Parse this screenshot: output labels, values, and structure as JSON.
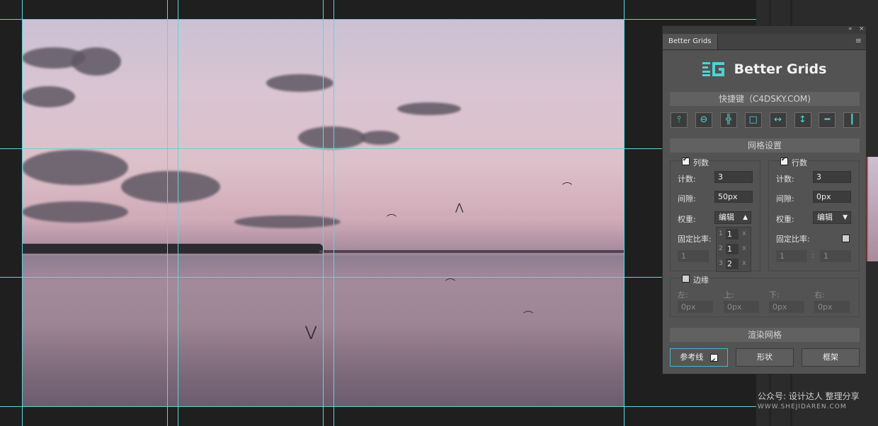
{
  "colors": {
    "guide": "#5fd6db",
    "accent": "#4fd2d6",
    "panel_bg": "#535353"
  },
  "panel": {
    "tab_title": "Better Grids",
    "brand_title": "Better Grids",
    "top_controls": {
      "collapse": "«",
      "close": "×"
    },
    "menu_icon": "≡"
  },
  "shortcuts": {
    "header": "快捷键（C4DSKY.COM)",
    "buttons": [
      {
        "icon": "center-vertical-line-icon",
        "glyph": "⫯"
      },
      {
        "icon": "center-horizontal-line-icon",
        "glyph": "⊖"
      },
      {
        "icon": "center-cross-icon",
        "glyph": "╬"
      },
      {
        "icon": "frame-square-icon",
        "glyph": "□"
      },
      {
        "icon": "horizontal-arrows-icon",
        "glyph": "↔"
      },
      {
        "icon": "vertical-arrows-icon",
        "glyph": "↕"
      },
      {
        "icon": "horizontal-line-icon",
        "glyph": "━"
      },
      {
        "icon": "vertical-line-icon",
        "glyph": "┃"
      }
    ]
  },
  "grid_settings": {
    "header": "网格设置",
    "columns": {
      "title": "列数",
      "checked": true,
      "count_label": "计数:",
      "count_value": "3",
      "gutter_label": "间隙:",
      "gutter_value": "50px",
      "weight_label": "权重:",
      "weight_value": "编辑",
      "ratio_label": "固定比率:",
      "ratio_value": "1",
      "weights": [
        {
          "index": "1",
          "value": "1",
          "x": "x"
        },
        {
          "index": "2",
          "value": "1",
          "x": "x"
        },
        {
          "index": "3",
          "value": "2",
          "x": "x"
        }
      ]
    },
    "rows": {
      "title": "行数",
      "checked": true,
      "count_label": "计数:",
      "count_value": "3",
      "gutter_label": "间隙:",
      "gutter_value": "0px",
      "weight_label": "权重:",
      "weight_value": "编辑",
      "ratio_label": "固定比率:",
      "ratio_a": "1",
      "ratio_sep": ":",
      "ratio_b": "1"
    },
    "margins": {
      "title": "边缘",
      "checked": false,
      "left_label": "左:",
      "left_value": "0px",
      "top_label": "上:",
      "top_value": "0px",
      "bottom_label": "下:",
      "bottom_value": "0px",
      "right_label": "右:",
      "right_value": "0px"
    }
  },
  "render": {
    "header": "渲染网格",
    "guides_label": "参考线",
    "shape_label": "形状",
    "frame_label": "框架"
  },
  "watermark": {
    "line1": "公众号: 设计达人 整理分享",
    "line2": "WWW.SHEJIDAREN.COM"
  }
}
